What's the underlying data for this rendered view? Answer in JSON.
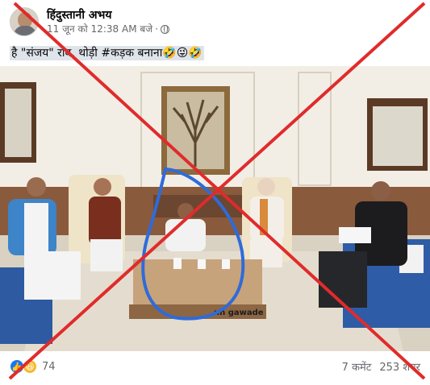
{
  "post": {
    "author": "हिंदुस्तानी अभय",
    "timestamp": "11 जून को 12:38 AM बजे",
    "privacy_icon": "globe-icon",
    "text": "है \"संजय\" राव, थोड़ी #कड़क बनाना🤣😜🤣",
    "watermark_text": "nh gawade"
  },
  "footer": {
    "reaction_icons": [
      "like-icon",
      "haha-icon"
    ],
    "reaction_count": "74",
    "comments": "7 कमेंट",
    "shares": "253 शेयर"
  },
  "colors": {
    "cross_red": "#e02b2b",
    "circle_blue": "#2f6bd9",
    "like_blue": "#1877f2",
    "haha_yellow": "#f7b928"
  }
}
